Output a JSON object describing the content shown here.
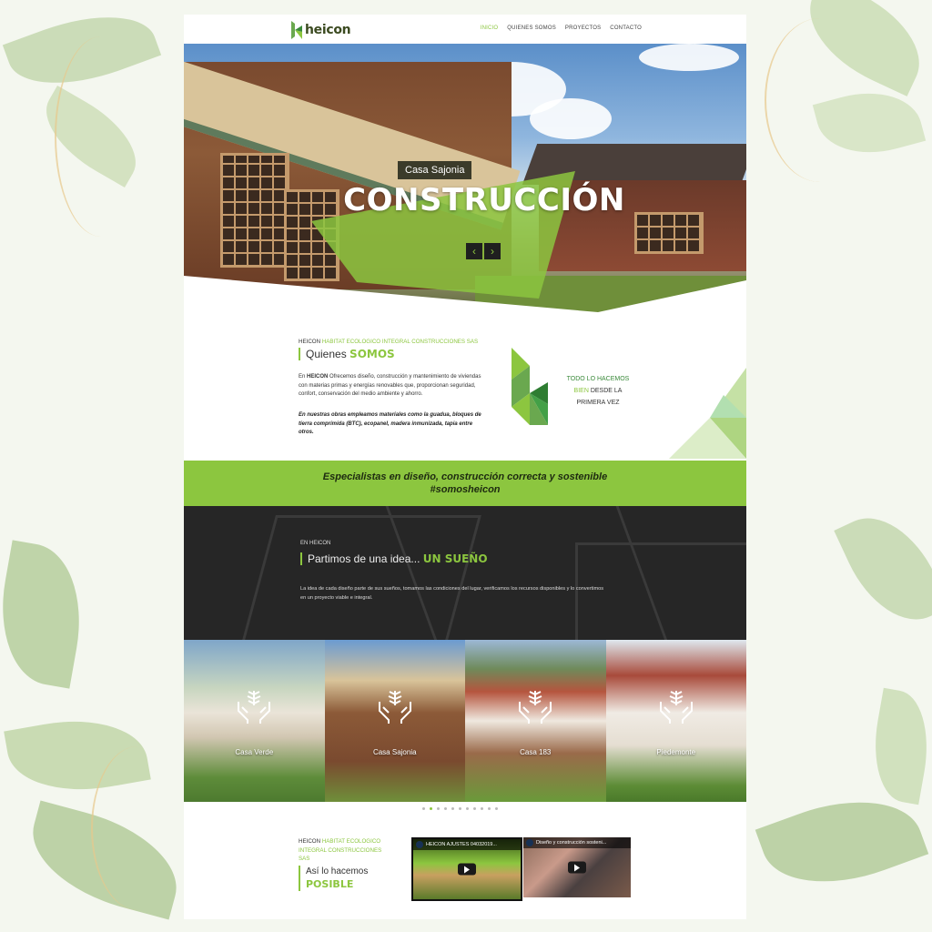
{
  "header": {
    "logo_text": "heicon",
    "nav": [
      {
        "label": "INICIO",
        "active": true
      },
      {
        "label": "QUIENES SOMOS",
        "active": false
      },
      {
        "label": "PROYECTOS",
        "active": false
      },
      {
        "label": "CONTACTO",
        "active": false
      }
    ]
  },
  "hero": {
    "label": "Casa Sajonia",
    "title": "CONSTRUCCIÓN",
    "prev_icon": "‹",
    "next_icon": "›"
  },
  "about": {
    "eyebrow_prefix": "HEICON",
    "eyebrow_green": "HABITAT ECOLOGICO INTEGRAL CONSTRUCCIONES SAS",
    "title_plain": "Quienes",
    "title_bold": "SOMOS",
    "p1_brand": "HEICON",
    "p1_text": "Ofrecemos diseño, construcción y mantenimiento de viviendas con materias primas y energías renovables que, proporcionan seguridad, confort, conservación del medio ambiente y ahorro.",
    "p2": "En nuestras obras empleamos materiales como la guadua, bloques de tierra comprimida (BTC), ecopanel, madera inmunizada, tapia entre otros.",
    "slogan_1": "TODO LO HACEMOS",
    "slogan_2a": "BIEN",
    "slogan_2b": "DESDE LA",
    "slogan_3": "PRIMERA VEZ"
  },
  "band": {
    "text": "Especialistas en diseño, construcción correcta y sostenible #somosheicon"
  },
  "dream": {
    "eyebrow": "EN HEICON",
    "title_plain": "Partimos de una idea...",
    "title_bold": "UN SUEÑO",
    "text": "La idea de cada diseño parte de sus sueños, tomamos las condiciones del lugar, verificamos los recursos disponibles y lo convertimos en un proyecto viable e integral."
  },
  "projects": [
    {
      "name": "Casa Verde"
    },
    {
      "name": "Casa Sajonia"
    },
    {
      "name": "Casa 183"
    },
    {
      "name": "Piedemonte"
    }
  ],
  "carousel": {
    "count": 11,
    "active_index": 1
  },
  "bottom": {
    "eyebrow_prefix": "HEICON",
    "eyebrow_green": "HABITAT ECOLOGICO INTEGRAL CONSTRUCCIONES SAS",
    "title_plain": "Así lo hacemos",
    "title_bold": "POSIBLE"
  },
  "videos": [
    {
      "title": "HEICON AJUSTES 04032019..."
    },
    {
      "title": "Diseño y construcción sosteni..."
    }
  ],
  "colors": {
    "accent": "#8cc63f",
    "dark": "#262626"
  }
}
